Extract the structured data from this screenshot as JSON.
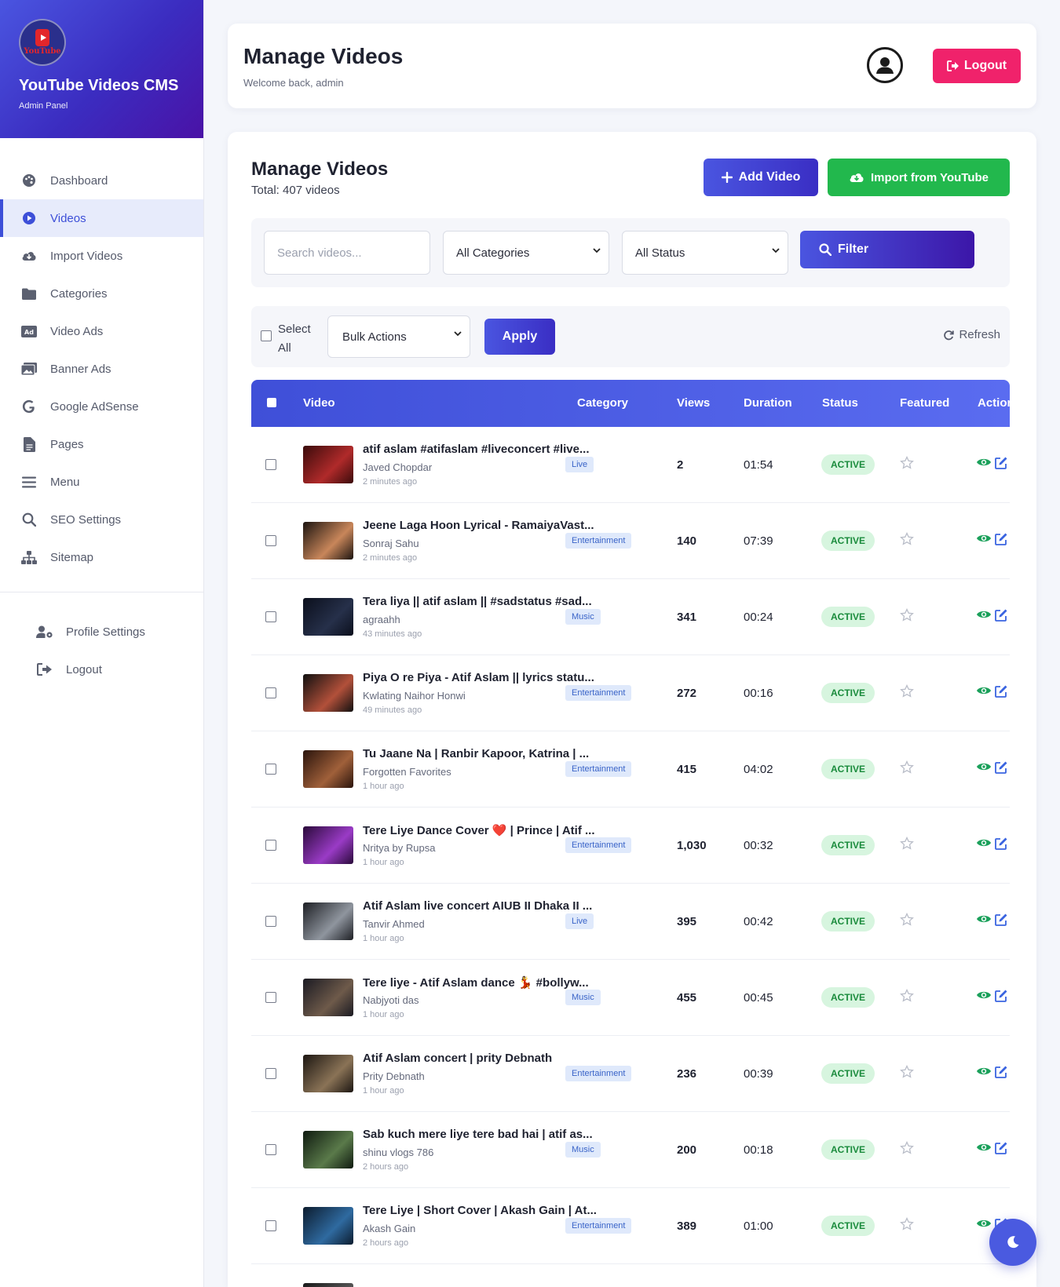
{
  "brand": {
    "logo_text": "YouTube",
    "title": "YouTube Videos CMS",
    "subtitle": "Admin Panel"
  },
  "nav": {
    "items": [
      {
        "label": "Dashboard",
        "icon": "palette-icon",
        "active": false
      },
      {
        "label": "Videos",
        "icon": "play-circle-icon",
        "active": true
      },
      {
        "label": "Import Videos",
        "icon": "cloud-download-icon",
        "active": false
      },
      {
        "label": "Categories",
        "icon": "folder-icon",
        "active": false
      },
      {
        "label": "Video Ads",
        "icon": "ad-icon",
        "active": false
      },
      {
        "label": "Banner Ads",
        "icon": "images-icon",
        "active": false
      },
      {
        "label": "Google AdSense",
        "icon": "google-icon",
        "active": false
      },
      {
        "label": "Pages",
        "icon": "file-icon",
        "active": false
      },
      {
        "label": "Menu",
        "icon": "bars-icon",
        "active": false
      },
      {
        "label": "SEO Settings",
        "icon": "search-icon",
        "active": false
      },
      {
        "label": "Sitemap",
        "icon": "sitemap-icon",
        "active": false
      }
    ],
    "secondary": [
      {
        "label": "Profile Settings",
        "icon": "user-cog-icon"
      },
      {
        "label": "Logout",
        "icon": "sign-out-icon"
      }
    ]
  },
  "header": {
    "title": "Manage Videos",
    "welcome": "Welcome back, admin",
    "logout_label": "Logout"
  },
  "main": {
    "title": "Manage Videos",
    "total": "Total: 407 videos",
    "add_label": "Add Video",
    "import_label": "Import from YouTube"
  },
  "filters": {
    "search_placeholder": "Search videos...",
    "category_value": "All Categories",
    "status_value": "All Status",
    "filter_label": "Filter"
  },
  "bulk": {
    "select_all_line1": "Select",
    "select_all_line2": "All",
    "bulk_value": "Bulk Actions",
    "apply_label": "Apply",
    "refresh_label": "Refresh"
  },
  "table": {
    "columns": [
      "Video",
      "Category",
      "Views",
      "Duration",
      "Status",
      "Featured",
      "Actions"
    ],
    "rows": [
      {
        "title": "atif aslam #atifaslam #liveconcert #live...",
        "channel": "Javed Chopdar",
        "ago": "2 minutes ago",
        "category": "Live",
        "views": "2",
        "duration": "01:54",
        "status": "ACTIVE",
        "thumb": [
          "#3a0b0b",
          "#b02a2a"
        ]
      },
      {
        "title": "Jeene Laga Hoon Lyrical - RamaiyaVast...",
        "channel": "Sonraj Sahu",
        "ago": "2 minutes ago",
        "category": "Entertainment",
        "views": "140",
        "duration": "07:39",
        "status": "ACTIVE",
        "thumb": [
          "#1b1410",
          "#c8865a"
        ]
      },
      {
        "title": "Tera liya || atif aslam || #sadstatus #sad...",
        "channel": "agraahh",
        "ago": "43 minutes ago",
        "category": "Music",
        "views": "341",
        "duration": "00:24",
        "status": "ACTIVE",
        "thumb": [
          "#0b0f1c",
          "#26304a"
        ]
      },
      {
        "title": "Piya O re Piya - Atif Aslam || lyrics statu...",
        "channel": "Kwlating Naihor Honwi",
        "ago": "49 minutes ago",
        "category": "Entertainment",
        "views": "272",
        "duration": "00:16",
        "status": "ACTIVE",
        "thumb": [
          "#101010",
          "#b2503a"
        ]
      },
      {
        "title": "Tu Jaane Na | Ranbir Kapoor, Katrina | ...",
        "channel": "Forgotten Favorites",
        "ago": "1 hour ago",
        "category": "Entertainment",
        "views": "415",
        "duration": "04:02",
        "status": "ACTIVE",
        "thumb": [
          "#2a140c",
          "#a0603a"
        ]
      },
      {
        "title": "Tere Liye Dance Cover ❤️ | Prince | Atif ...",
        "channel": "Nritya by Rupsa",
        "ago": "1 hour ago",
        "category": "Entertainment",
        "views": "1,030",
        "duration": "00:32",
        "status": "ACTIVE",
        "thumb": [
          "#2a0a3a",
          "#9a3bc6"
        ]
      },
      {
        "title": "Atif Aslam live concert AIUB II Dhaka II ...",
        "channel": "Tanvir Ahmed",
        "ago": "1 hour ago",
        "category": "Live",
        "views": "395",
        "duration": "00:42",
        "status": "ACTIVE",
        "thumb": [
          "#1d1f24",
          "#8f959e"
        ]
      },
      {
        "title": "Tere liye - Atif Aslam dance 💃 #bollyw...",
        "channel": "Nabjyoti das",
        "ago": "1 hour ago",
        "category": "Music",
        "views": "455",
        "duration": "00:45",
        "status": "ACTIVE",
        "thumb": [
          "#1a1a22",
          "#6e5a4a"
        ]
      },
      {
        "title": "Atif Aslam concert | prity Debnath",
        "channel": "Prity Debnath",
        "ago": "1 hour ago",
        "category": "Entertainment",
        "views": "236",
        "duration": "00:39",
        "status": "ACTIVE",
        "thumb": [
          "#1c1612",
          "#8a7356"
        ]
      },
      {
        "title": "Sab kuch mere liye tere bad hai | atif as...",
        "channel": "shinu vlogs 786",
        "ago": "2 hours ago",
        "category": "Music",
        "views": "200",
        "duration": "00:18",
        "status": "ACTIVE",
        "thumb": [
          "#0f1a10",
          "#5a7a4a"
        ]
      },
      {
        "title": "Tere Liye | Short Cover | Akash Gain | At...",
        "channel": "Akash Gain",
        "ago": "2 hours ago",
        "category": "Entertainment",
        "views": "389",
        "duration": "01:00",
        "status": "ACTIVE",
        "thumb": [
          "#0c1c2e",
          "#2f6aa0"
        ]
      },
      {
        "title": "",
        "channel": "",
        "ago": "",
        "category": "",
        "views": "",
        "duration": "",
        "status": "",
        "thumb": [
          "#1a1a1a",
          "#555555"
        ]
      }
    ]
  },
  "colors": {
    "primary": "#3d4fd8",
    "logout": "#f0226b",
    "import": "#22b84d",
    "status_active_bg": "#d7f5df",
    "status_active_text": "#1a8b3c",
    "action_view": "#1aa05a",
    "action_edit": "#3a64e0"
  }
}
